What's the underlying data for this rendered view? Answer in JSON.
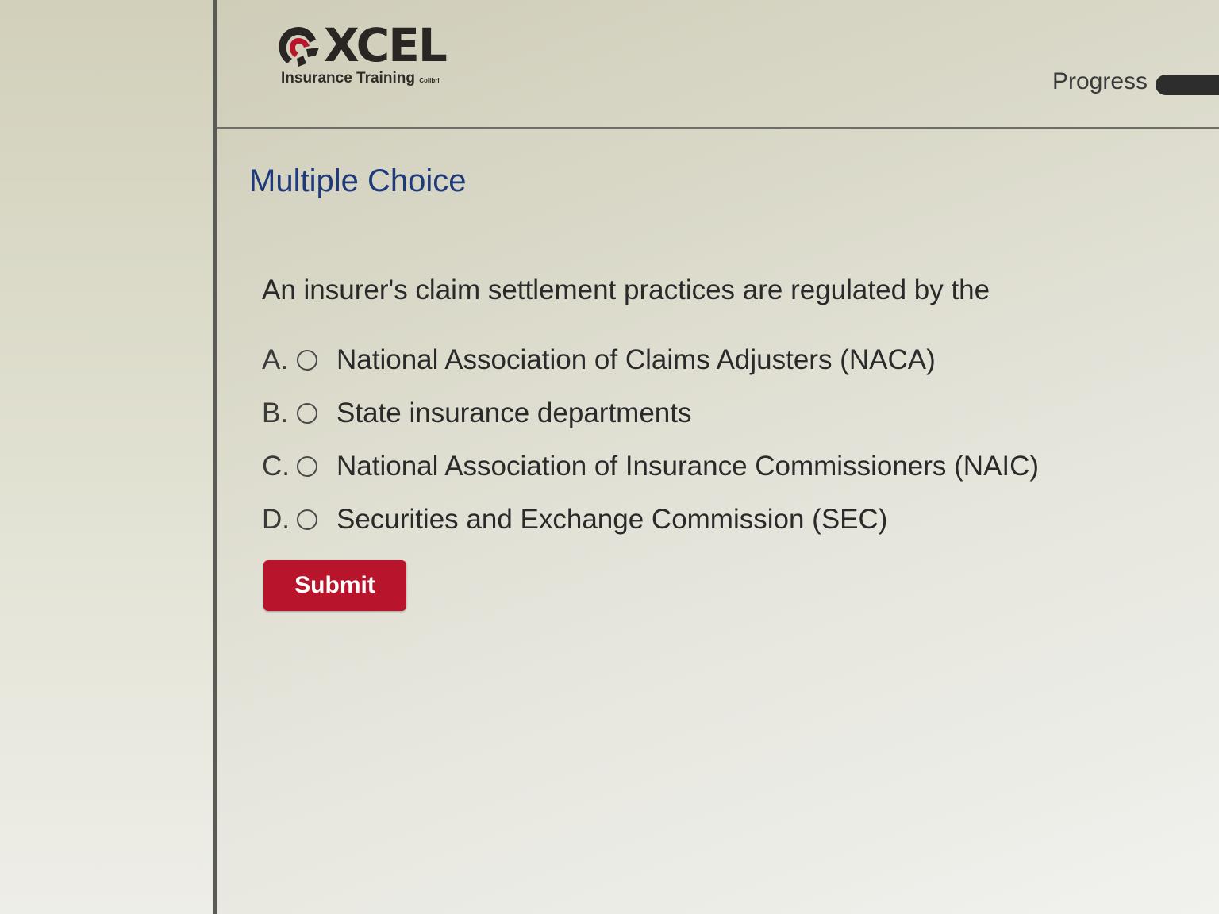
{
  "brand": {
    "logo_word": "XCEL",
    "tagline": "Insurance Training",
    "tagline_suffix": "Colibri",
    "accent_color": "#b8142b"
  },
  "header": {
    "progress_label": "Progress"
  },
  "quiz": {
    "section_title": "Multiple Choice",
    "question": "An insurer's claim settlement practices are regulated by the",
    "options": [
      {
        "letter": "A.",
        "text": "National Association of Claims Adjusters (NACA)"
      },
      {
        "letter": "B.",
        "text": "State insurance departments"
      },
      {
        "letter": "C.",
        "text": "National Association of Insurance Commissioners (NAIC)"
      },
      {
        "letter": "D.",
        "text": "Securities and Exchange Commission (SEC)"
      }
    ],
    "submit_label": "Submit"
  }
}
